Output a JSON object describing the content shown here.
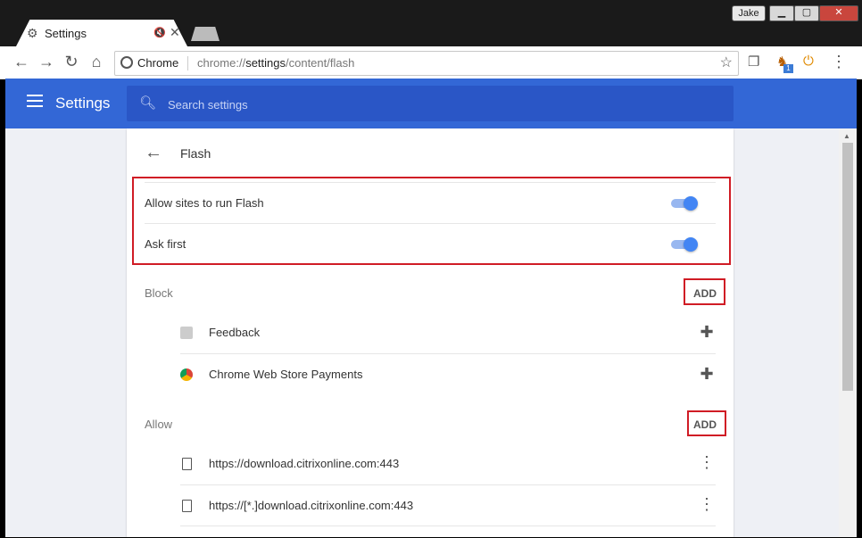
{
  "window": {
    "user": "Jake",
    "minimize": "▁",
    "maximize": "▢",
    "close": "✕"
  },
  "tab": {
    "title": "Settings",
    "mute_icon": "🔇",
    "close_icon": "✕"
  },
  "toolbar": {
    "back_icon": "←",
    "forward_icon": "→",
    "reload_icon": "↻",
    "home_icon": "⌂",
    "chip": "Chrome",
    "url_prefix": "chrome://",
    "url_host": "settings",
    "url_path": "/content/flash",
    "star_icon": "☆",
    "menu_icon": "⋮",
    "ext_badge": "1"
  },
  "header": {
    "title": "Settings",
    "search_placeholder": "Search settings"
  },
  "flash": {
    "title": "Flash",
    "toggles": [
      {
        "label": "Allow sites to run Flash",
        "on": true
      },
      {
        "label": "Ask first",
        "on": true
      }
    ],
    "block": {
      "label": "Block",
      "add_label": "ADD",
      "items": [
        {
          "label": "Feedback",
          "icon": "puzzle-icon"
        },
        {
          "label": "Chrome Web Store Payments",
          "icon": "puzzle-icon"
        }
      ]
    },
    "allow": {
      "label": "Allow",
      "add_label": "ADD",
      "items": [
        {
          "label": "https://download.citrixonline.com:443"
        },
        {
          "label": "https://[*.]download.citrixonline.com:443"
        }
      ]
    }
  },
  "colors": {
    "header": "#3367d6",
    "search": "#2a56c6",
    "toggle_on": "#4285f4",
    "highlight": "#d01c25"
  }
}
